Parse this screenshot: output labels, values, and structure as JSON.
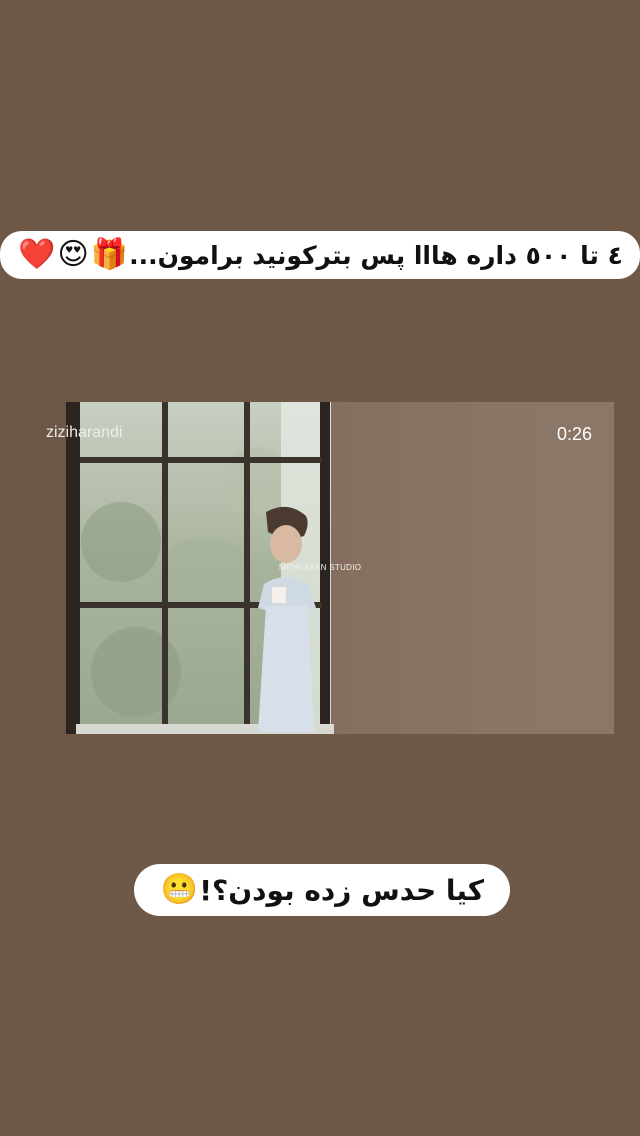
{
  "story": {
    "top_caption": {
      "text": "٤ تا ٥٠٠ داره هاﺍﺍ پس بترکونید برامون...",
      "emojis": [
        "🎁",
        "😍",
        "❤️"
      ]
    },
    "video": {
      "username": "ziziharandi",
      "duration": "0:26",
      "watermark": "MEHRABAN STUDIO"
    },
    "bottom_caption": {
      "text": "کیا حدس زده بودن؟!",
      "emoji": "😬"
    }
  },
  "colors": {
    "background": "#6e5848",
    "caption_bg": "#ffffff",
    "caption_text": "#111111"
  }
}
